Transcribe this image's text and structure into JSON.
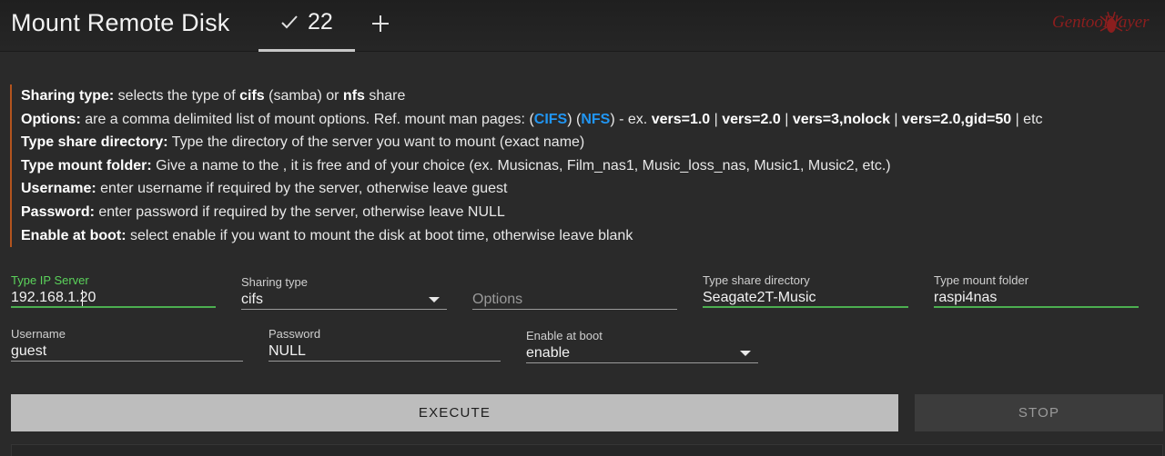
{
  "header": {
    "title": "Mount Remote Disk",
    "active_tab": {
      "icon": "check-icon",
      "count": "22"
    },
    "add_tab_icon": "plus-icon",
    "brand": "GentooPlayer"
  },
  "help": {
    "accent_color": "#b3541e",
    "link_color": "#2196f3",
    "lines": {
      "sharing_type": {
        "label": "Sharing type:",
        "t1": " selects the type of ",
        "b1": "cifs",
        "t2": " (samba) or ",
        "b2": "nfs",
        "t3": " share"
      },
      "options": {
        "label": "Options:",
        "t1": " are a comma delimited list of mount options. Ref. mount man pages: (",
        "link_cifs": "CIFS",
        "t2": ") (",
        "link_nfs": "NFS",
        "t3": ") - ex. ",
        "ex1": "vers=1.0",
        "sep1": " | ",
        "ex2": "vers=2.0",
        "sep2": " | ",
        "ex3": "vers=3,nolock",
        "sep3": " | ",
        "ex4": "vers=2.0,gid=50",
        "t4": " | etc"
      },
      "share_dir": {
        "label": "Type share directory:",
        "text": " Type the directory of the server you want to mount (exact name)"
      },
      "mount_folder": {
        "label": "Type mount folder:",
        "text": " Give a name to the , it is free and of your choice (ex. Musicnas, Film_nas1, Music_loss_nas, Music1, Music2, etc.)"
      },
      "username": {
        "label": "Username:",
        "text": " enter username if required by the server, otherwise leave guest"
      },
      "password": {
        "label": "Password:",
        "text": " enter password if required by the server, otherwise leave NULL"
      },
      "boot": {
        "label": "Enable at boot:",
        "text": " select enable if you want to mount the disk at boot time, otherwise leave blank"
      }
    }
  },
  "form": {
    "ip_server": {
      "label": "Type IP Server",
      "value": "192.168.1.20"
    },
    "sharing_type": {
      "label": "Sharing type",
      "value": "cifs"
    },
    "options": {
      "placeholder": "Options"
    },
    "share_dir": {
      "label": "Type share directory",
      "value": "Seagate2T-Music"
    },
    "mount_folder": {
      "label": "Type mount folder",
      "value": "raspi4nas"
    },
    "username": {
      "label": "Username",
      "value": "guest"
    },
    "password": {
      "label": "Password",
      "value": "NULL"
    },
    "enable_boot": {
      "label": "Enable at boot",
      "value": "enable"
    },
    "focus_color": "#4caf50"
  },
  "actions": {
    "execute": "EXECUTE",
    "stop": "STOP"
  }
}
